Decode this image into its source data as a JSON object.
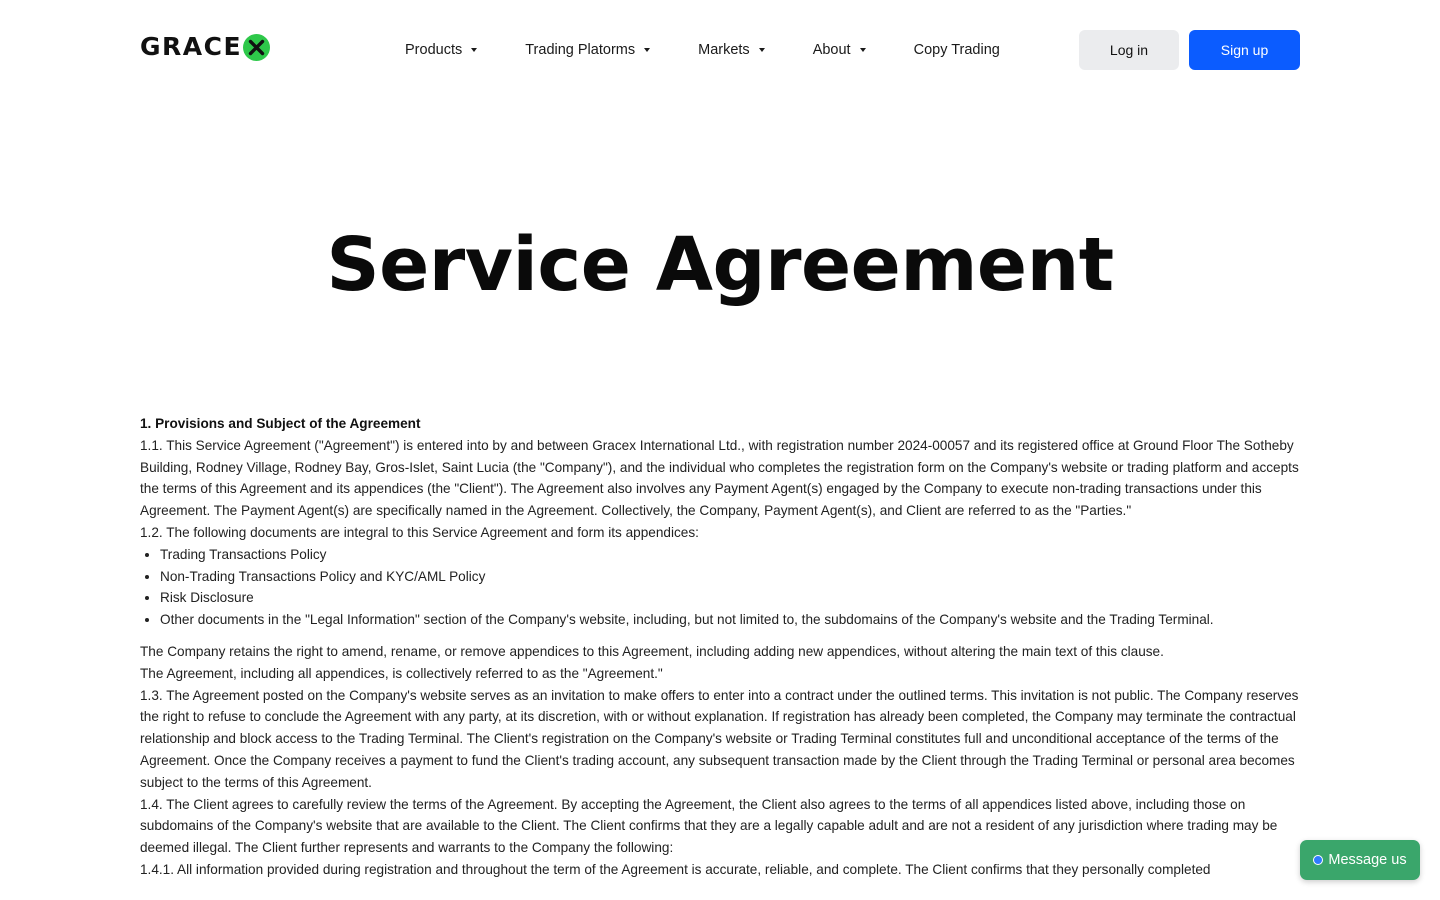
{
  "header": {
    "logo_text": "GRACE",
    "logo_x": "X",
    "nav": {
      "products": "Products",
      "trading_platforms": "Trading Platorms",
      "markets": "Markets",
      "about": "About",
      "copy_trading": "Copy Trading"
    },
    "login_label": "Log in",
    "signup_label": "Sign up"
  },
  "page": {
    "title": "Service Agreement"
  },
  "document": {
    "section1_heading": "1. Provisions and Subject of the Agreement",
    "p1_1": "1.1. This Service Agreement (\"Agreement\") is entered into by and between Gracex International Ltd., with registration number 2024-00057 and its registered office at Ground Floor The Sotheby Building, Rodney Village, Rodney Bay, Gros-Islet, Saint Lucia (the \"Company\"), and the individual who completes the registration form on the Company's website or trading platform and accepts the terms of this Agreement and its appendices (the \"Client\"). The Agreement also involves any Payment Agent(s) engaged by the Company to execute non-trading transactions under this Agreement. The Payment Agent(s) are specifically named in the Agreement. Collectively, the Company, Payment Agent(s), and Client are referred to as the \"Parties.\"",
    "p1_2": "1.2. The following documents are integral to this Service Agreement and form its appendices:",
    "appendices": [
      "Trading Transactions Policy",
      "Non-Trading Transactions Policy and KYC/AML Policy",
      "Risk Disclosure",
      "Other documents in the \"Legal Information\" section of the Company's website, including, but not limited to, the subdomains of the Company's website and the Trading Terminal."
    ],
    "p_amend": "The Company retains the right to amend, rename, or remove appendices to this Agreement, including adding new appendices, without altering the main text of this clause.",
    "p_collective": "The Agreement, including all appendices, is collectively referred to as the \"Agreement.\"",
    "p1_3": "1.3. The Agreement posted on the Company's website serves as an invitation to make offers to enter into a contract under the outlined terms. This invitation is not public. The Company reserves the right to refuse to conclude the Agreement with any party, at its discretion, with or without explanation. If registration has already been completed, the Company may terminate the contractual relationship and block access to the Trading Terminal. The Client's registration on the Company's website or Trading Terminal constitutes full and unconditional acceptance of the terms of the Agreement. Once the Company receives a payment to fund the Client's trading account, any subsequent transaction made by the Client through the Trading Terminal or personal area becomes subject to the terms of this Agreement.",
    "p1_4": "1.4. The Client agrees to carefully review the terms of the Agreement. By accepting the Agreement, the Client also agrees to the terms of all appendices listed above, including those on subdomains of the Company's website that are available to the Client. The Client confirms that they are a legally capable adult and are not a resident of any jurisdiction where trading may be deemed illegal. The Client further represents and warrants to the Company the following:",
    "p1_4_1": "1.4.1. All information provided during registration and throughout the term of the Agreement is accurate, reliable, and complete. The Client confirms that they personally completed"
  },
  "chat": {
    "label": "Message us"
  },
  "colors": {
    "brand_green": "#2ec84a",
    "primary_blue": "#0b5cff",
    "chat_green": "#3aa66b",
    "login_bg": "#ebecee"
  }
}
